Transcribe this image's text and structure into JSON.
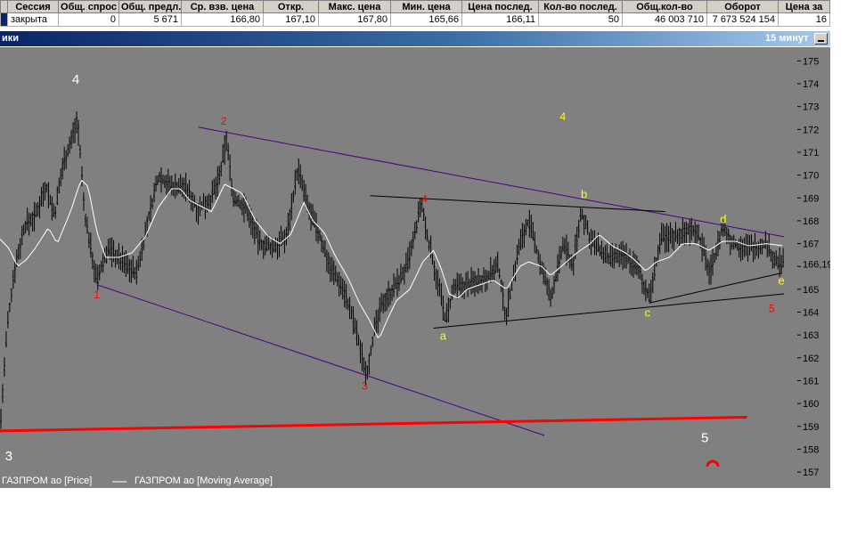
{
  "quote_table": {
    "headers": [
      "Сессия",
      "Общ. спрос",
      "Общ. предл.",
      "Ср. взв. цена",
      "Откр.",
      "Макс. цена",
      "Мин. цена",
      "Цена послед.",
      "Кол-во послед.",
      "Общ.кол-во",
      "Оборот",
      "Цена за"
    ],
    "row": [
      "закрыта",
      "0",
      "5 671",
      "166,80",
      "167,10",
      "167,80",
      "165,66",
      "166,11",
      "50",
      "46 003 710",
      "7 673 524 154",
      "16"
    ]
  },
  "window": {
    "title": "ики",
    "interval": "15 минут"
  },
  "chart_data": {
    "type": "line",
    "instrument": "ГАЗПРОМ ао",
    "x_range": [
      0,
      900
    ],
    "ylim": [
      156.3,
      175.6
    ],
    "y_ticks": [
      175,
      174,
      173,
      172,
      171,
      170,
      169,
      168,
      167,
      166,
      165,
      164,
      163,
      162,
      161,
      160,
      159,
      158,
      157
    ],
    "y_tick_labels": [
      "175",
      "174",
      "173",
      "172",
      "171",
      "170",
      "169",
      "168",
      "167",
      "",
      "165",
      "164",
      "163",
      "162",
      "161",
      "160",
      "159",
      "158",
      "157"
    ],
    "last_price_label": "166,19",
    "last_price": 166.11,
    "series": [
      {
        "name": "ГАЗПРОМ ао [Price]",
        "legend": "ГАЗПРОМ ао [Price]",
        "color": "#000000",
        "keypoints": [
          [
            0,
            158.8
          ],
          [
            8,
            163.2
          ],
          [
            16,
            165.8
          ],
          [
            28,
            167.8
          ],
          [
            40,
            168.2
          ],
          [
            52,
            169.6
          ],
          [
            62,
            168.2
          ],
          [
            72,
            170.6
          ],
          [
            80,
            171.4
          ],
          [
            88,
            172.5
          ],
          [
            96,
            168.3
          ],
          [
            104,
            166.6
          ],
          [
            110,
            165.3
          ],
          [
            122,
            166.8
          ],
          [
            140,
            166.2
          ],
          [
            155,
            165.7
          ],
          [
            168,
            168.0
          ],
          [
            180,
            170.0
          ],
          [
            195,
            169.5
          ],
          [
            210,
            169.5
          ],
          [
            225,
            168.5
          ],
          [
            240,
            169.0
          ],
          [
            250,
            170.0
          ],
          [
            257,
            171.6
          ],
          [
            265,
            169.0
          ],
          [
            280,
            168.5
          ],
          [
            295,
            167.0
          ],
          [
            310,
            166.8
          ],
          [
            325,
            167.3
          ],
          [
            338,
            170.3
          ],
          [
            350,
            168.5
          ],
          [
            362,
            167.4
          ],
          [
            375,
            166.0
          ],
          [
            390,
            165.0
          ],
          [
            402,
            163.5
          ],
          [
            410,
            162.2
          ],
          [
            416,
            161.3
          ],
          [
            424,
            163.0
          ],
          [
            435,
            164.5
          ],
          [
            450,
            165.2
          ],
          [
            462,
            166.0
          ],
          [
            470,
            167.2
          ],
          [
            478,
            168.8
          ],
          [
            484,
            167.5
          ],
          [
            490,
            166.5
          ],
          [
            500,
            164.8
          ],
          [
            506,
            163.6
          ],
          [
            515,
            165.0
          ],
          [
            530,
            165.2
          ],
          [
            550,
            165.5
          ],
          [
            566,
            166.0
          ],
          [
            574,
            163.8
          ],
          [
            590,
            167.0
          ],
          [
            600,
            168.0
          ],
          [
            612,
            166.3
          ],
          [
            625,
            164.6
          ],
          [
            640,
            167.0
          ],
          [
            650,
            166.0
          ],
          [
            660,
            168.4
          ],
          [
            670,
            167.2
          ],
          [
            690,
            166.3
          ],
          [
            710,
            166.5
          ],
          [
            725,
            165.8
          ],
          [
            737,
            164.6
          ],
          [
            750,
            167.2
          ],
          [
            770,
            167.4
          ],
          [
            790,
            167.7
          ],
          [
            800,
            166.5
          ],
          [
            806,
            165.7
          ],
          [
            820,
            167.7
          ],
          [
            832,
            167.0
          ],
          [
            850,
            166.8
          ],
          [
            870,
            167.0
          ],
          [
            880,
            166.2
          ],
          [
            890,
            166.1
          ]
        ]
      },
      {
        "name": "ГАЗПРОМ ао [Moving Average]",
        "legend": "ГАЗПРОМ ао [Moving Average]",
        "color": "#ffffff",
        "keypoints": [
          [
            0,
            167.2
          ],
          [
            10,
            166.8
          ],
          [
            20,
            166.0
          ],
          [
            30,
            166.3
          ],
          [
            40,
            166.8
          ],
          [
            55,
            167.7
          ],
          [
            65,
            167.0
          ],
          [
            80,
            168.4
          ],
          [
            92,
            169.8
          ],
          [
            100,
            169.5
          ],
          [
            110,
            167.5
          ],
          [
            120,
            166.4
          ],
          [
            135,
            166.4
          ],
          [
            150,
            166.6
          ],
          [
            165,
            167.3
          ],
          [
            180,
            168.6
          ],
          [
            195,
            169.4
          ],
          [
            205,
            169.4
          ],
          [
            215,
            168.9
          ],
          [
            225,
            168.7
          ],
          [
            240,
            168.4
          ],
          [
            255,
            169.6
          ],
          [
            265,
            169.4
          ],
          [
            275,
            169.2
          ],
          [
            290,
            168.0
          ],
          [
            305,
            167.3
          ],
          [
            318,
            167.0
          ],
          [
            330,
            167.4
          ],
          [
            345,
            168.8
          ],
          [
            355,
            168.0
          ],
          [
            368,
            167.5
          ],
          [
            380,
            166.5
          ],
          [
            395,
            165.5
          ],
          [
            408,
            164.4
          ],
          [
            420,
            163.6
          ],
          [
            430,
            162.8
          ],
          [
            440,
            163.7
          ],
          [
            450,
            164.5
          ],
          [
            465,
            165.0
          ],
          [
            480,
            166.2
          ],
          [
            492,
            166.7
          ],
          [
            500,
            166.0
          ],
          [
            510,
            164.8
          ],
          [
            520,
            164.6
          ],
          [
            530,
            165.0
          ],
          [
            545,
            165.2
          ],
          [
            560,
            165.4
          ],
          [
            575,
            165.0
          ],
          [
            590,
            166.0
          ],
          [
            600,
            166.2
          ],
          [
            615,
            166.0
          ],
          [
            625,
            165.6
          ],
          [
            640,
            166.1
          ],
          [
            655,
            166.6
          ],
          [
            670,
            167.0
          ],
          [
            680,
            167.4
          ],
          [
            695,
            166.9
          ],
          [
            710,
            166.6
          ],
          [
            720,
            166.3
          ],
          [
            733,
            165.8
          ],
          [
            745,
            166.2
          ],
          [
            760,
            166.4
          ],
          [
            775,
            167.0
          ],
          [
            790,
            167.0
          ],
          [
            805,
            166.7
          ],
          [
            820,
            167.1
          ],
          [
            835,
            167.1
          ],
          [
            850,
            166.9
          ],
          [
            870,
            167.0
          ],
          [
            890,
            166.9
          ]
        ]
      }
    ],
    "annotations": [
      {
        "text": "4",
        "x": 86,
        "y": 174.0,
        "color": "#ffffff",
        "size": 15
      },
      {
        "text": "3",
        "x": 10,
        "y": 157.5,
        "color": "#ffffff",
        "size": 15
      },
      {
        "text": "1",
        "x": 110,
        "y": 164.6,
        "color": "#ff0000",
        "size": 12
      },
      {
        "text": "2",
        "x": 254,
        "y": 172.2,
        "color": "#ff0000",
        "size": 12
      },
      {
        "text": "3",
        "x": 414,
        "y": 160.6,
        "color": "#ff0000",
        "size": 12
      },
      {
        "text": "4",
        "x": 482,
        "y": 168.8,
        "color": "#ff0000",
        "size": 12
      },
      {
        "text": "4",
        "x": 639,
        "y": 172.4,
        "color": "#ffff00",
        "size": 12
      },
      {
        "text": "a",
        "x": 503,
        "y": 162.8,
        "color": "#ffff00",
        "size": 13
      },
      {
        "text": "b",
        "x": 663,
        "y": 169.0,
        "color": "#ffff00",
        "size": 13
      },
      {
        "text": "c",
        "x": 735,
        "y": 163.8,
        "color": "#ffff00",
        "size": 13
      },
      {
        "text": "d",
        "x": 821,
        "y": 167.9,
        "color": "#ffff00",
        "size": 13
      },
      {
        "text": "e",
        "x": 887,
        "y": 165.2,
        "color": "#ffff00",
        "size": 13
      },
      {
        "text": "5",
        "x": 876,
        "y": 164.0,
        "color": "#ff0000",
        "size": 12
      },
      {
        "text": "5",
        "x": 800,
        "y": 158.3,
        "color": "#ffffff",
        "size": 15
      }
    ],
    "trendlines": [
      {
        "color": "#4b0082",
        "width": 1,
        "points": [
          [
            225,
            172.1
          ],
          [
            890,
            167.3
          ]
        ]
      },
      {
        "color": "#4b0082",
        "width": 1,
        "points": [
          [
            110,
            165.2
          ],
          [
            618,
            158.6
          ]
        ]
      },
      {
        "color": "#000000",
        "width": 1,
        "points": [
          [
            420,
            169.1
          ],
          [
            755,
            168.4
          ]
        ]
      },
      {
        "color": "#000000",
        "width": 1,
        "points": [
          [
            492,
            163.3
          ],
          [
            890,
            164.8
          ]
        ]
      },
      {
        "color": "#000000",
        "width": 1,
        "points": [
          [
            737,
            164.4
          ],
          [
            886,
            165.7
          ]
        ]
      },
      {
        "color": "#ff0000",
        "width": 3,
        "points": [
          [
            0,
            158.8
          ],
          [
            848,
            159.4
          ]
        ]
      }
    ]
  }
}
